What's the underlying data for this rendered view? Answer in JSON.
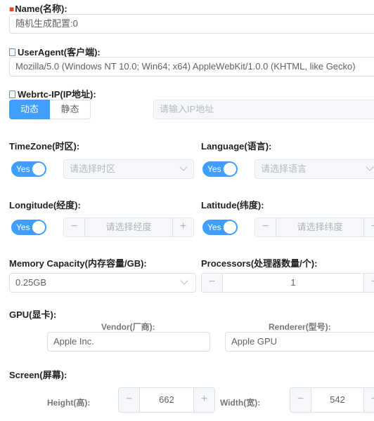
{
  "name": {
    "label": "Name(名称):",
    "value": "随机生成配置:0"
  },
  "user_agent": {
    "label": "UserAgent(客户端):",
    "value": "Mozilla/5.0 (Windows NT 10.0; Win64; x64) AppleWebKit/1.0.0 (KHTML, like Gecko)"
  },
  "webrtc": {
    "label": "Webrtc-IP(IP地址):",
    "modes": [
      "动态",
      "静态"
    ],
    "selected": "动态",
    "ip_placeholder": "请输入IP地址"
  },
  "timezone": {
    "label": "TimeZone(时区):",
    "switch_text": "Yes",
    "placeholder": "请选择时区"
  },
  "language": {
    "label": "Language(语言):",
    "switch_text": "Yes",
    "placeholder": "请选择语言"
  },
  "longitude": {
    "label": "Longitude(经度):",
    "switch_text": "Yes",
    "placeholder": "请选择经度"
  },
  "latitude": {
    "label": "Latitude(纬度):",
    "switch_text": "Yes",
    "placeholder": "请选择纬度"
  },
  "memory": {
    "label": "Memory Capacity(内存容量/GB):",
    "value": "0.25GB"
  },
  "processors": {
    "label": "Processors(处理器数量/个):",
    "value": "1"
  },
  "gpu": {
    "label": "GPU(显卡):",
    "vendor_label": "Vendor(厂商):",
    "vendor_value": "Apple Inc.",
    "renderer_label": "Renderer(型号):",
    "renderer_value": "Apple GPU"
  },
  "screen": {
    "label": "Screen(屏幕):",
    "height_label": "Height(高):",
    "height_value": "662",
    "width_label": "Width(宽):",
    "width_value": "542"
  },
  "glyphs": {
    "minus": "−",
    "plus": "+"
  },
  "colors": {
    "accent": "#409eff",
    "required": "#e8471b"
  }
}
